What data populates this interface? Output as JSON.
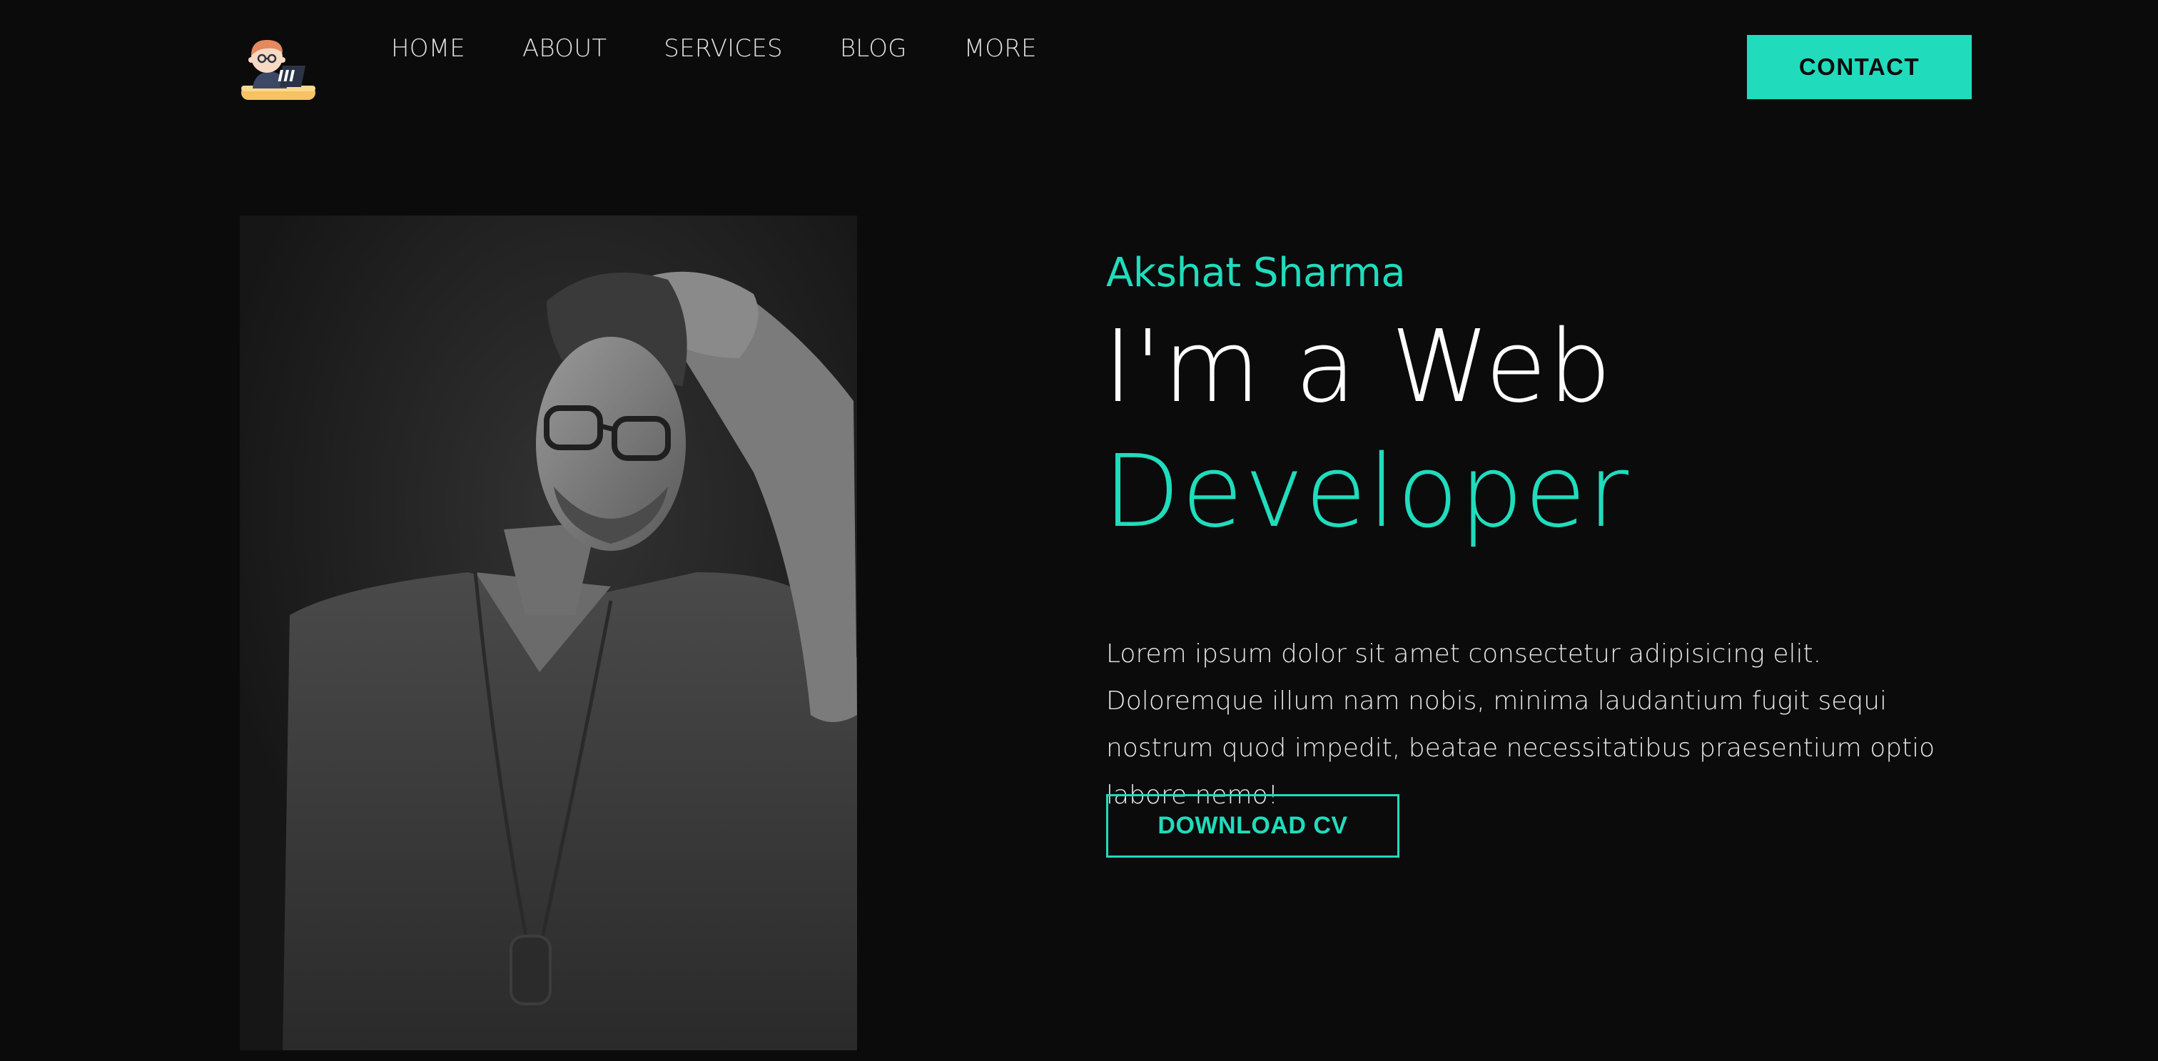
{
  "header": {
    "logo_icon": "developer-avatar-icon",
    "nav": [
      {
        "label": "HOME"
      },
      {
        "label": "ABOUT"
      },
      {
        "label": "SERVICES"
      },
      {
        "label": "BLOG"
      },
      {
        "label": "MORE"
      }
    ],
    "contact_label": "CONTACT"
  },
  "hero": {
    "name": "Akshat Sharma",
    "title_line1": "I'm a Web",
    "title_line2": "Developer",
    "description": "Lorem ipsum dolor sit amet consectetur adipisicing elit. Doloremque illum nam nobis, minima laudantium fugit sequi nostrum quod impedit, beatae necessitatibus praesentium optio labore nemo!",
    "cta_label": "DOWNLOAD CV",
    "portrait_icon": "portrait-photo"
  },
  "colors": {
    "background": "#0b0b0b",
    "accent": "#20dcbc",
    "text": "#ffffff"
  }
}
